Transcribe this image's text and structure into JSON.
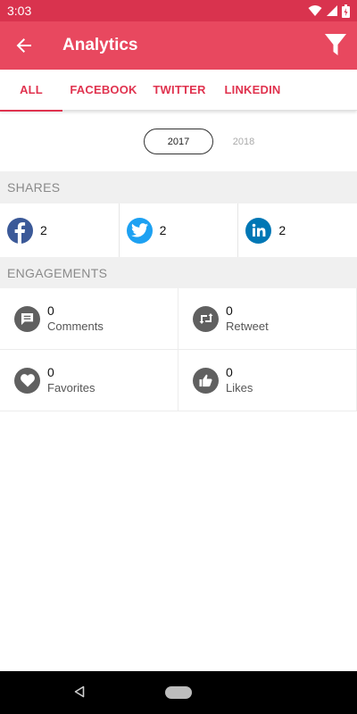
{
  "status_bar": {
    "time": "3:03"
  },
  "app_bar": {
    "title": "Analytics"
  },
  "tabs": [
    {
      "label": "ALL",
      "active": true
    },
    {
      "label": "FACEBOOK",
      "active": false
    },
    {
      "label": "TWITTER",
      "active": false
    },
    {
      "label": "LINKEDIN",
      "active": false
    }
  ],
  "years": {
    "selected": "2017",
    "other": "2018"
  },
  "shares": {
    "header": "SHARES",
    "items": [
      {
        "icon": "facebook-icon",
        "count": "2",
        "color": "#3b5998"
      },
      {
        "icon": "twitter-icon",
        "count": "2",
        "color": "#1da1f2"
      },
      {
        "icon": "linkedin-icon",
        "count": "2",
        "color": "#0077b5"
      }
    ]
  },
  "engagements": {
    "header": "ENGAGEMENTS",
    "items": [
      {
        "icon": "comment-icon",
        "count": "0",
        "label": "Comments"
      },
      {
        "icon": "retweet-icon",
        "count": "0",
        "label": "Retweet"
      },
      {
        "icon": "heart-icon",
        "count": "0",
        "label": "Favorites"
      },
      {
        "icon": "thumbs-up-icon",
        "count": "0",
        "label": "Likes"
      }
    ]
  },
  "colors": {
    "primary": "#e8485f",
    "status": "#d9334e",
    "accent": "#e0334f"
  }
}
